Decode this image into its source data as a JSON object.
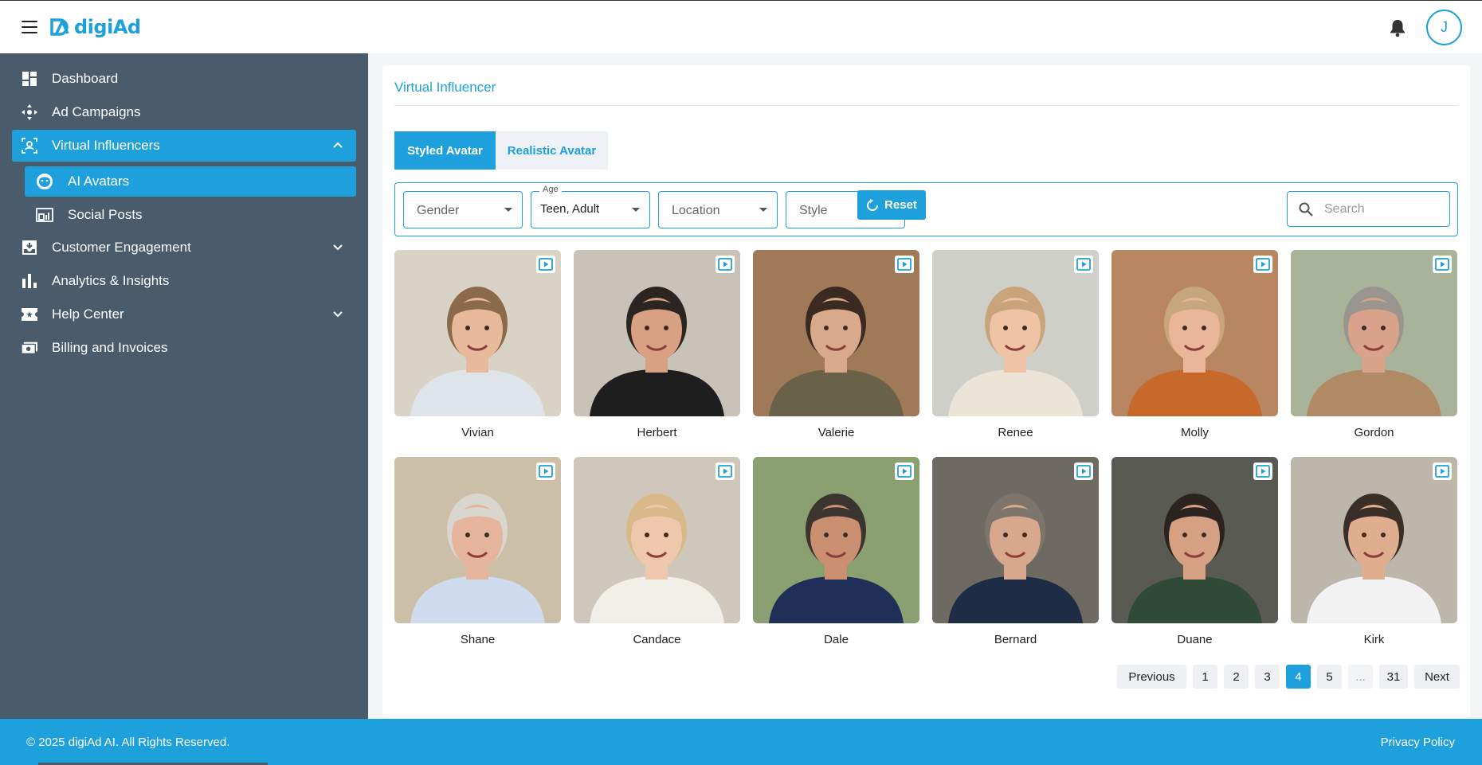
{
  "app": {
    "logo_text": "digiAd",
    "user_initial": "J",
    "brand_color": "#1da0dc"
  },
  "sidebar": {
    "items": [
      {
        "label": "Dashboard",
        "icon": "dashboard-icon"
      },
      {
        "label": "Ad Campaigns",
        "icon": "campaigns-icon"
      },
      {
        "label": "Virtual Influencers",
        "icon": "virtual-influencer-icon",
        "expanded": true
      },
      {
        "label": "AI Avatars",
        "icon": "ai-avatar-icon",
        "sub": true,
        "active": true
      },
      {
        "label": "Social Posts",
        "icon": "social-posts-icon",
        "sub": true
      },
      {
        "label": "Customer Engagement",
        "icon": "engagement-icon",
        "collapsed": true
      },
      {
        "label": "Analytics & Insights",
        "icon": "analytics-icon"
      },
      {
        "label": "Help Center",
        "icon": "help-center-icon",
        "collapsed": true
      },
      {
        "label": "Billing and Invoices",
        "icon": "billing-icon"
      }
    ]
  },
  "main": {
    "title": "Virtual Influencer",
    "tabs": [
      {
        "label": "Styled Avatar",
        "active": true
      },
      {
        "label": "Realistic Avatar",
        "active": false
      }
    ],
    "filters": {
      "gender": {
        "placeholder": "Gender"
      },
      "age": {
        "label": "Age",
        "value": "Teen, Adult"
      },
      "location": {
        "placeholder": "Location"
      },
      "style": {
        "placeholder": "Style"
      },
      "reset_label": "Reset",
      "search_placeholder": "Search"
    },
    "avatars": [
      {
        "name": "Vivian",
        "skin": "#e8b99a",
        "hair": "#8a6a4a",
        "shirt": "#dfe3ea",
        "bg": "#d9d2c6"
      },
      {
        "name": "Herbert",
        "skin": "#d9a183",
        "hair": "#2b2522",
        "shirt": "#1e1e1e",
        "bg": "#c8c2b8"
      },
      {
        "name": "Valerie",
        "skin": "#d9a98c",
        "hair": "#3a2a22",
        "shirt": "#6a6248",
        "bg": "#a07a58"
      },
      {
        "name": "Renee",
        "skin": "#eec3a6",
        "hair": "#c9a47a",
        "shirt": "#ece4d6",
        "bg": "#cfcfca"
      },
      {
        "name": "Molly",
        "skin": "#eab69a",
        "hair": "#c8a67c",
        "shirt": "#c8692c",
        "bg": "#b88660"
      },
      {
        "name": "Gordon",
        "skin": "#d8a38a",
        "hair": "#9a958e",
        "shirt": "#b08a64",
        "bg": "#a9b39a"
      },
      {
        "name": "Shane",
        "skin": "#e6b49c",
        "hair": "#d9d6cf",
        "shirt": "#cfdbef",
        "bg": "#cbbfa8"
      },
      {
        "name": "Candace",
        "skin": "#efc7ac",
        "hair": "#d9b989",
        "shirt": "#f2efe8",
        "bg": "#cfc7bb"
      },
      {
        "name": "Dale",
        "skin": "#c98f70",
        "hair": "#3b3530",
        "shirt": "#1f2f57",
        "bg": "#8aa070"
      },
      {
        "name": "Bernard",
        "skin": "#d8a88c",
        "hair": "#7d756c",
        "shirt": "#1e2d45",
        "bg": "#6e6a62"
      },
      {
        "name": "Duane",
        "skin": "#d6a083",
        "hair": "#2a2320",
        "shirt": "#2f4a37",
        "bg": "#5a5a55"
      },
      {
        "name": "Kirk",
        "skin": "#e0ad8e",
        "hair": "#3a2e28",
        "shirt": "#f2f2f2",
        "bg": "#bdb7ab"
      }
    ]
  },
  "pagination": {
    "previous": "Previous",
    "next": "Next",
    "pages": [
      "1",
      "2",
      "3",
      "4",
      "5",
      "...",
      "31"
    ],
    "current": "4"
  },
  "footer": {
    "copyright": "© 2025 digiAd AI. All Rights Reserved.",
    "privacy": "Privacy Policy"
  }
}
